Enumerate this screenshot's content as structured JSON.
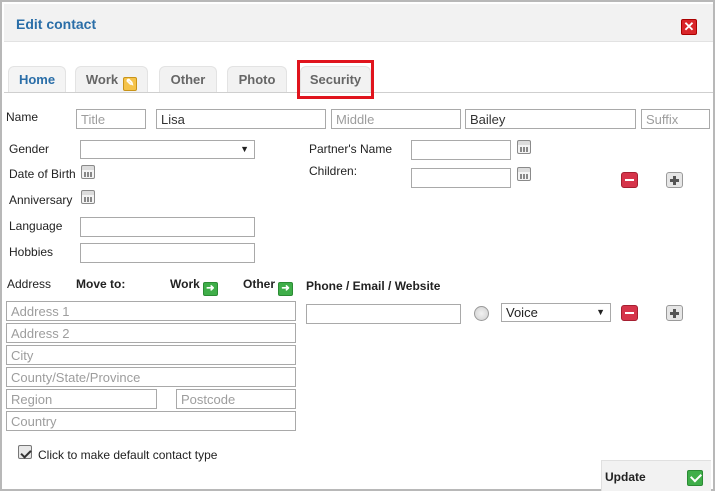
{
  "window": {
    "title": "Edit contact"
  },
  "tabs": [
    {
      "label": "Home"
    },
    {
      "label": "Work"
    },
    {
      "label": "Other"
    },
    {
      "label": "Photo"
    },
    {
      "label": "Security"
    }
  ],
  "name": {
    "label": "Name",
    "title_placeholder": "Title",
    "first_value": "Lisa",
    "middle_placeholder": "Middle",
    "last_value": "Bailey",
    "suffix_placeholder": "Suffix"
  },
  "personal": {
    "gender_label": "Gender",
    "gender_value": "",
    "dob_label": "Date of Birth",
    "anniversary_label": "Anniversary",
    "language_label": "Language",
    "hobbies_label": "Hobbies",
    "partner_label": "Partner's Name",
    "children_label": "Children:"
  },
  "address": {
    "label": "Address",
    "move_to_label": "Move to:",
    "work_label": "Work",
    "other_label": "Other",
    "address1_placeholder": "Address 1",
    "address2_placeholder": "Address 2",
    "city_placeholder": "City",
    "county_placeholder": "County/State/Province",
    "region_placeholder": "Region",
    "postcode_placeholder": "Postcode",
    "country_placeholder": "Country"
  },
  "phone": {
    "label": "Phone / Email / Website",
    "type_value": "Voice"
  },
  "footer": {
    "default_type_label": "Click to make default contact type",
    "update_label": "Update"
  },
  "icons": {
    "close": "close-icon",
    "calendar": "calendar-icon",
    "remove": "minus-icon",
    "add": "plus-icon",
    "arrow": "arrow-right-icon",
    "check": "check-icon"
  },
  "colors": {
    "accent": "#2a6ea8",
    "highlight": "#e0141d",
    "remove": "#d6344a",
    "confirm": "#3fae49"
  }
}
